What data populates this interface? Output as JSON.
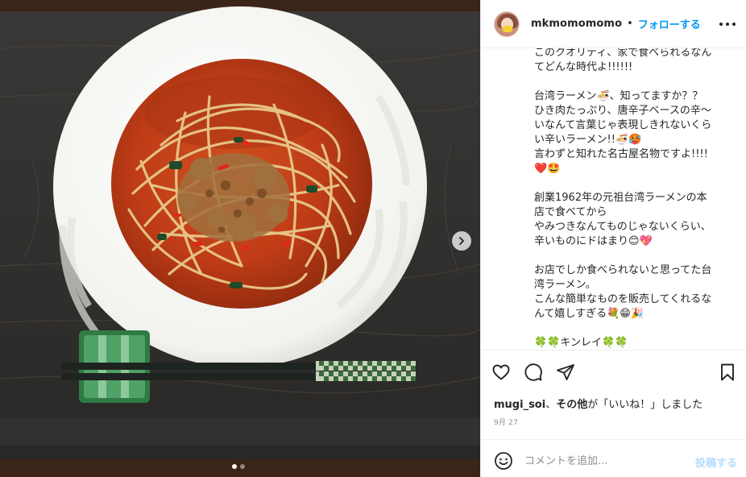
{
  "post": {
    "username": "mkmomomomo",
    "separator": "•",
    "follow_label": "フォローする",
    "more_icon": "more-horizontal-icon"
  },
  "caption": {
    "paragraphs": [
      [
        "このクオリティ、家で食べられるなん",
        "てどんな時代よ!!!!!!"
      ],
      [
        "台湾ラーメン🍜、知ってますか？？",
        "ひき肉たっぷり、唐辛子ベースの辛〜",
        "いなんて言葉じゃ表現しきれないくら",
        "い辛いラーメン!!🍜🥵",
        "言わずと知れた名古屋名物ですよ!!!!",
        "❤️🤩"
      ],
      [
        "創業1962年の元祖台湾ラーメンの本",
        "店で食べてから",
        "やみつきなんてものじゃないくらい、",
        "辛いものにドはまり😊💖"
      ],
      [
        "お店でしか食べられないと思ってた台",
        "湾ラーメン。",
        "こんな簡単なものを販売してくれるな",
        "んて嬉しすぎる💐😁🎉"
      ],
      [
        "🍀🍀キンレイ🍀🍀"
      ]
    ]
  },
  "actions": {
    "like_icon": "heart-icon",
    "comment_icon": "comment-icon",
    "share_icon": "send-icon",
    "save_icon": "bookmark-icon"
  },
  "likes": {
    "user": "mugi_soi",
    "mid": "、",
    "others": "その他",
    "suffix": "が「いいね！」しました"
  },
  "date": "9月 27",
  "comment": {
    "placeholder": "コメントを追加...",
    "post_label": "投稿する",
    "emoji_icon": "smile-icon"
  },
  "carousel": {
    "current": 1,
    "total": 2,
    "next_icon": "chevron-right-icon"
  },
  "colors": {
    "link": "#0095f6",
    "text": "#262626",
    "muted": "#8e8e8e",
    "post_disabled": "#b3dbff"
  }
}
